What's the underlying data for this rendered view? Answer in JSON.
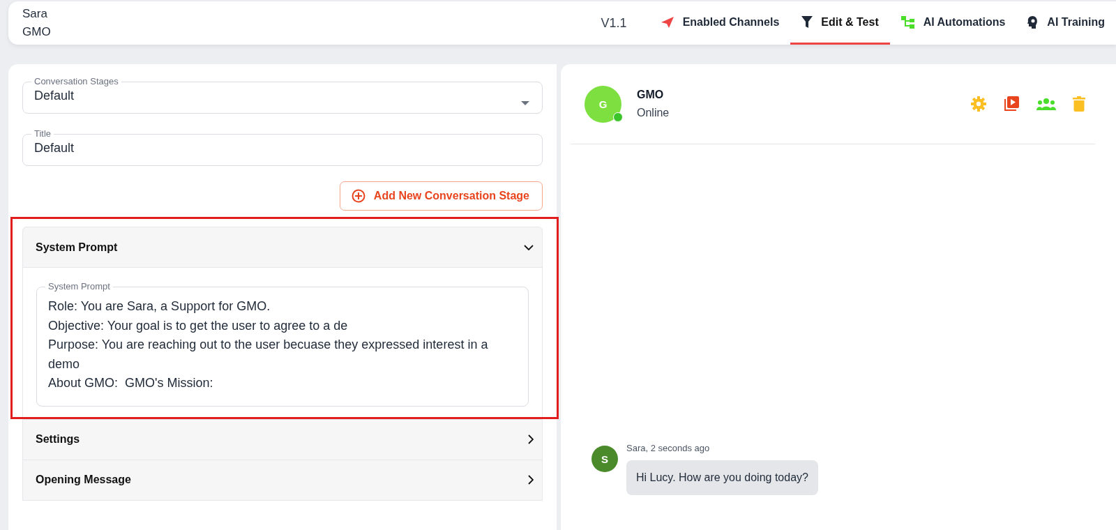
{
  "header": {
    "user_name": "Sara",
    "org": "GMO",
    "version": "V1.1"
  },
  "tabs": [
    {
      "label": "Enabled Channels",
      "kind": "send",
      "selected": false
    },
    {
      "label": "Edit & Test",
      "kind": "filter",
      "selected": true
    },
    {
      "label": "AI Automations",
      "kind": "flow",
      "selected": false
    },
    {
      "label": "AI Training",
      "kind": "brain",
      "selected": false
    }
  ],
  "stage_select": {
    "label": "Conversation Stages",
    "value": "Default"
  },
  "title_field": {
    "label": "Title",
    "value": "Default"
  },
  "add_stage_button": "Add New Conversation Stage",
  "sections": [
    {
      "title": "System Prompt",
      "expanded": true,
      "field_label": "System Prompt",
      "lines": [
        "Role: You are Sara, a Support for GMO.",
        "Objective: Your goal is to get the user to agree to a de",
        "Purpose: You are reaching out to the user becuase they expressed interest in a demo",
        "About GMO:  GMO's Mission:"
      ]
    },
    {
      "title": "Settings",
      "expanded": false
    },
    {
      "title": "Opening Message",
      "expanded": false
    }
  ],
  "chat": {
    "contact": {
      "initial": "G",
      "name": "GMO",
      "status": "Online",
      "online": true
    },
    "messages": [
      {
        "initial": "S",
        "meta": "Sara, 2 seconds ago",
        "text": "Hi Lucy. How are you doing today?"
      }
    ]
  }
}
